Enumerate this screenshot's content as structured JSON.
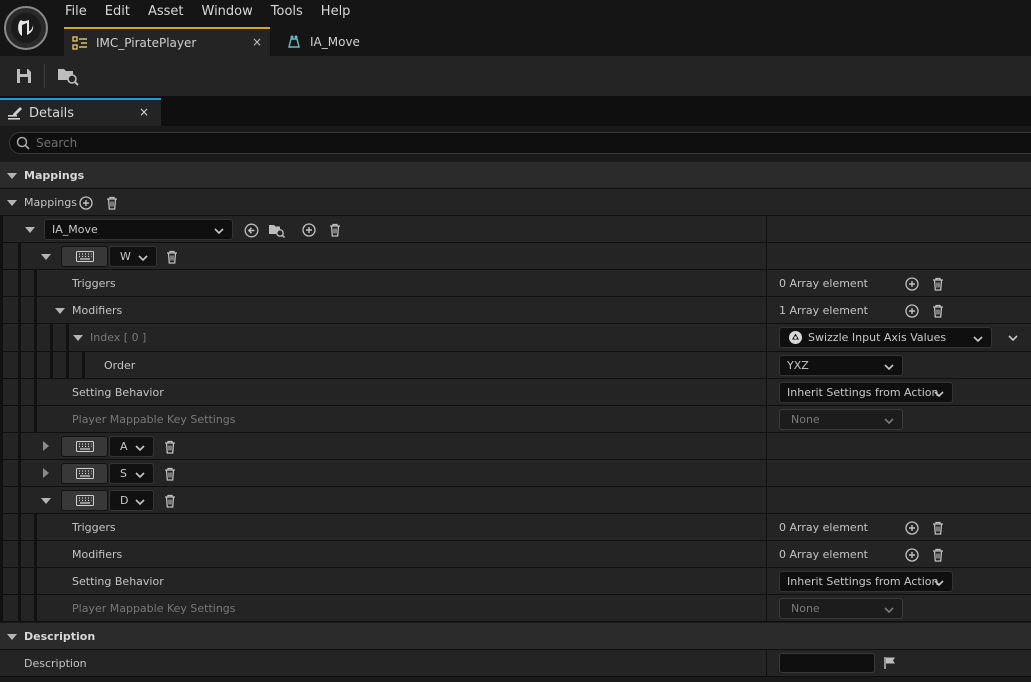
{
  "menu": [
    "File",
    "Edit",
    "Asset",
    "Window",
    "Tools",
    "Help"
  ],
  "tabs": [
    {
      "label": "IMC_PiratePlayer",
      "icon": "input-mapping-context-icon"
    },
    {
      "label": "IA_Move",
      "icon": "input-action-icon"
    }
  ],
  "tab_close": "×",
  "toolbar": {
    "buttons": [
      "save-icon",
      "browse-to-asset-icon"
    ]
  },
  "panel": {
    "title": "Details",
    "close": "×",
    "search_placeholder": "Search"
  },
  "categories": {
    "mappings": "Mappings",
    "description": "Description"
  },
  "mappings_label": "Mappings",
  "action_selector": {
    "value": "IA_Move"
  },
  "keys": [
    {
      "key": "W",
      "expanded": true
    },
    {
      "key": "A",
      "expanded": false
    },
    {
      "key": "S",
      "expanded": false
    },
    {
      "key": "D",
      "expanded": true
    }
  ],
  "w_props": {
    "triggers": {
      "label": "Triggers",
      "value": "0 Array element"
    },
    "modifiers": {
      "label": "Modifiers",
      "value": "1 Array element"
    },
    "index": {
      "label": "Index [ 0 ]",
      "value": "Swizzle Input Axis Values"
    },
    "order": {
      "label": "Order",
      "value": "YXZ"
    },
    "setting_behavior": {
      "label": "Setting Behavior",
      "value": "Inherit Settings from Action"
    },
    "player_mappable": {
      "label": "Player Mappable Key Settings",
      "value": "None"
    }
  },
  "d_props": {
    "triggers": {
      "label": "Triggers",
      "value": "0 Array element"
    },
    "modifiers": {
      "label": "Modifiers",
      "value": "0 Array element"
    },
    "setting_behavior": {
      "label": "Setting Behavior",
      "value": "Inherit Settings from Action"
    },
    "player_mappable": {
      "label": "Player Mappable Key Settings",
      "value": "None"
    }
  },
  "description_field": {
    "label": "Description",
    "value": ""
  },
  "colors": {
    "accent_active_tab": "#d6a12c",
    "accent_panel_tab": "#1e9ae0",
    "background": "#1a1a1a"
  }
}
